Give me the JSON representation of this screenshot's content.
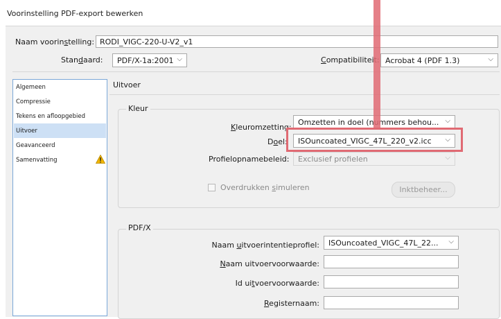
{
  "window": {
    "title": "Voorinstelling PDF-export bewerken"
  },
  "preset": {
    "name_label_pre": "Naam voorin",
    "name_label_ul": "s",
    "name_label_post": "telling:",
    "name_value": "RODI_VIGC-220-U-V2_v1",
    "standard_label_pre": "Stan",
    "standard_label_ul": "d",
    "standard_label_post": "aard:",
    "standard_value": "PDF/X-1a:2001",
    "compat_label_ul": "C",
    "compat_label_post": "ompatibiliteit:",
    "compat_value": "Acrobat 4 (PDF 1.3)"
  },
  "sidebar": {
    "items": [
      {
        "label": "Algemeen"
      },
      {
        "label": "Compressie"
      },
      {
        "label": "Tekens en afloopgebied"
      },
      {
        "label": "Uitvoer"
      },
      {
        "label": "Geavanceerd"
      },
      {
        "label": "Samenvatting"
      }
    ],
    "selected_index": 3
  },
  "panel": {
    "heading": "Uitvoer",
    "color_group": {
      "title": "Kleur",
      "conversion_label_ul": "K",
      "conversion_label_post": "leuromzetting:",
      "conversion_value": "Omzetten in doel (nummers behou...",
      "target_label_pre": "D",
      "target_label_ul": "o",
      "target_label_post": "el:",
      "target_value": "ISOuncoated_VIGC_47L_220_v2.icc",
      "profile_label_pre": "Prof",
      "profile_label_ul": "i",
      "profile_label_post": "elopnamebeleid:",
      "profile_value": "Exclusief profielen",
      "overprint_label_pre": "Overdrukken ",
      "overprint_label_ul": "s",
      "overprint_label_post": "imuleren",
      "ink_button": "Inktbeheer..."
    },
    "pdfx_group": {
      "title": "PDF/X",
      "output_intent_label_pre": "Naam ",
      "output_intent_label_ul": "u",
      "output_intent_label_post": "itvoerintentieprofiel:",
      "output_intent_value": "ISOuncoated_VIGC_47L_22...",
      "condition_name_label_ul": "N",
      "condition_name_label_post": "aam uitvoervoorwaarde:",
      "condition_id_label_pre": "Id ui",
      "condition_id_label_ul": "t",
      "condition_id_label_post": "voervoorwaarde:",
      "registry_label_ul": "R",
      "registry_label_post": "egisternaam:"
    }
  },
  "colors": {
    "highlight": "#e06a73",
    "selection": "#cde0f5",
    "warning": "#f2b600"
  }
}
